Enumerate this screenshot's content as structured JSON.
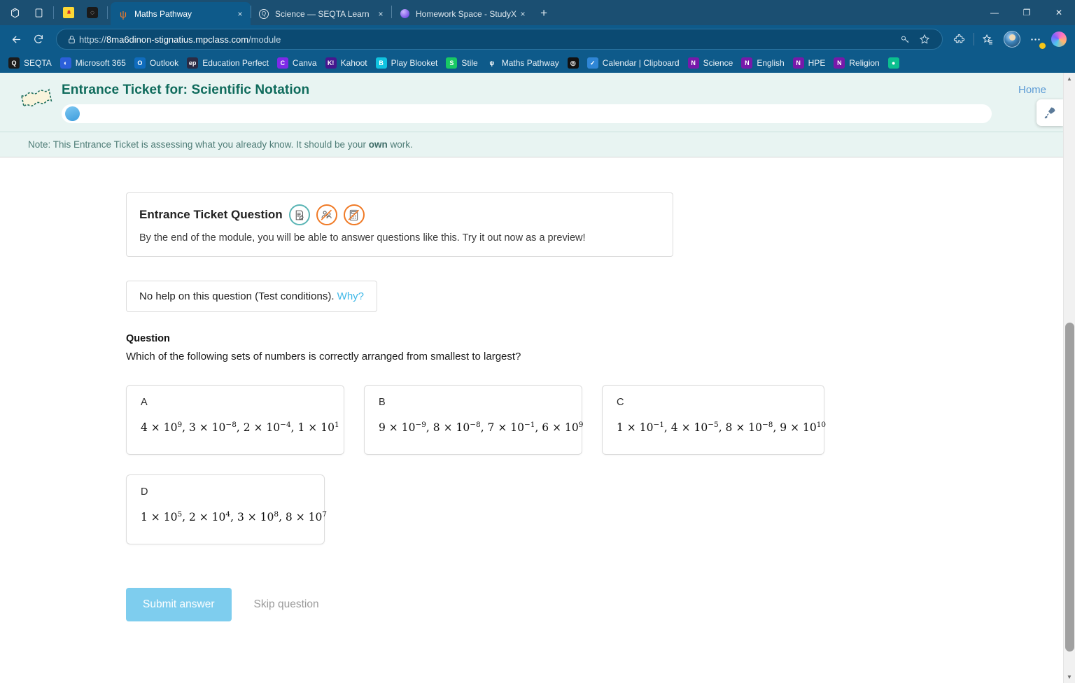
{
  "browser": {
    "system_icons": [
      "copilot-sidebar-icon",
      "split-screen-icon",
      "app1-icon",
      "app2-icon"
    ],
    "tabs": [
      {
        "title": "Maths Pathway",
        "favicon": "maths-pathway-icon",
        "active": true,
        "close": "×"
      },
      {
        "title": "Science — SEQTA Learn",
        "favicon": "seqta-icon",
        "active": false,
        "close": "×"
      },
      {
        "title": "Homework Space - StudyX",
        "favicon": "studyx-icon",
        "active": false,
        "close": "×"
      }
    ],
    "new_tab_label": "+",
    "window_controls": {
      "minimize": "—",
      "maximize": "❐",
      "close": "✕"
    },
    "nav": {
      "back": "←",
      "forward": "→",
      "reload": "↻",
      "url_protocol": "https://",
      "url_host": "8ma6dinon-stignatius.mpclass.com",
      "url_path": "/module",
      "lock_icon": "lock-icon",
      "split_icon": "split-icon",
      "favorite_icon": "star-icon",
      "key_icon": "key-icon",
      "extensions_icon": "puzzle-icon",
      "collections_icon": "collections-icon",
      "profile_icon": "avatar-icon",
      "settings_icon": "ellipsis-icon",
      "copilot_icon": "copilot-icon"
    },
    "bookmarks": [
      {
        "label": "SEQTA",
        "icon": "seqta-icon",
        "color": "#1b1b1b",
        "glyph": "Q"
      },
      {
        "label": "Microsoft 365",
        "icon": "microsoft-365-icon",
        "color": "#2b5fd9",
        "glyph": "◐"
      },
      {
        "label": "Outlook",
        "icon": "outlook-icon",
        "color": "#0f6cbd",
        "glyph": "O"
      },
      {
        "label": "Education Perfect",
        "icon": "education-perfect-icon",
        "color": "#2b2b44",
        "glyph": "ep"
      },
      {
        "label": "Canva",
        "icon": "canva-icon",
        "color": "#7d2ae8",
        "glyph": "C"
      },
      {
        "label": "Kahoot",
        "icon": "kahoot-icon",
        "color": "#46178f",
        "glyph": "K!"
      },
      {
        "label": "Play Blooket",
        "icon": "blooket-icon",
        "color": "#10c3e0",
        "glyph": "B"
      },
      {
        "label": "Stile",
        "icon": "stile-icon",
        "color": "#18c964",
        "glyph": "S"
      },
      {
        "label": "Maths Pathway",
        "icon": "maths-pathway-icon",
        "color": "#0e5a8a",
        "glyph": "ψ"
      },
      {
        "label": "",
        "icon": "chatgpt-icon",
        "color": "#111111",
        "glyph": "◎"
      },
      {
        "label": "Calendar | Clipboard",
        "icon": "calendar-clipboard-icon",
        "color": "#2f86d6",
        "glyph": "✓"
      },
      {
        "label": "Science",
        "icon": "onenote-icon",
        "color": "#7719aa",
        "glyph": "N"
      },
      {
        "label": "English",
        "icon": "onenote-icon",
        "color": "#7719aa",
        "glyph": "N"
      },
      {
        "label": "HPE",
        "icon": "onenote-icon",
        "color": "#7719aa",
        "glyph": "N"
      },
      {
        "label": "Religion",
        "icon": "onenote-icon",
        "color": "#7719aa",
        "glyph": "N"
      },
      {
        "label": "",
        "icon": "education-perfect-green-icon",
        "color": "#0bbf8f",
        "glyph": "●"
      }
    ]
  },
  "page": {
    "header": {
      "ticket_icon": "ticket-icon",
      "title": "Entrance Ticket for: Scientific Notation",
      "home_label": "Home",
      "progress_percent": 0
    },
    "note": {
      "prefix": "Note: This Entrance Ticket is assessing what you already know. It should be your ",
      "emphasis": "own",
      "suffix": " work."
    },
    "entrance_ticket_card": {
      "title": "Entrance Ticket Question",
      "subtitle": "By the end of the module, you will be able to answer questions like this. Try it out now as a preview!",
      "icons": [
        "write-notepad-icon",
        "no-collaboration-icon",
        "no-calculator-icon"
      ]
    },
    "help_card": {
      "text": "No help on this question (Test conditions). ",
      "link": "Why?"
    },
    "question": {
      "label": "Question",
      "text": "Which of the following sets of numbers is correctly arranged from smallest to largest?",
      "options": [
        {
          "letter": "A",
          "terms": [
            {
              "coeff": "4",
              "exp": "9"
            },
            {
              "coeff": "3",
              "exp": "−8"
            },
            {
              "coeff": "2",
              "exp": "−4"
            },
            {
              "coeff": "1",
              "exp": "1"
            }
          ]
        },
        {
          "letter": "B",
          "terms": [
            {
              "coeff": "9",
              "exp": "−9"
            },
            {
              "coeff": "8",
              "exp": "−8"
            },
            {
              "coeff": "7",
              "exp": "−1"
            },
            {
              "coeff": "6",
              "exp": "9"
            }
          ]
        },
        {
          "letter": "C",
          "terms": [
            {
              "coeff": "1",
              "exp": "−1"
            },
            {
              "coeff": "4",
              "exp": "−5"
            },
            {
              "coeff": "8",
              "exp": "−8"
            },
            {
              "coeff": "9",
              "exp": "10"
            }
          ]
        },
        {
          "letter": "D",
          "terms": [
            {
              "coeff": "1",
              "exp": "5"
            },
            {
              "coeff": "2",
              "exp": "4"
            },
            {
              "coeff": "3",
              "exp": "8"
            },
            {
              "coeff": "8",
              "exp": "7"
            }
          ]
        }
      ]
    },
    "actions": {
      "submit_label": "Submit answer",
      "skip_label": "Skip question"
    },
    "fab": {
      "icon": "rocket-icon"
    },
    "scrollbar": {
      "up": "▲",
      "down": "▼"
    }
  },
  "colors": {
    "brand_teal": "#0f6b5c",
    "header_bg": "#e8f4f2",
    "submit_blue": "#7ecdee",
    "link_blue": "#3fb8e8",
    "browser_blue": "#0e5a8a",
    "icon_orange": "#f07a26"
  }
}
